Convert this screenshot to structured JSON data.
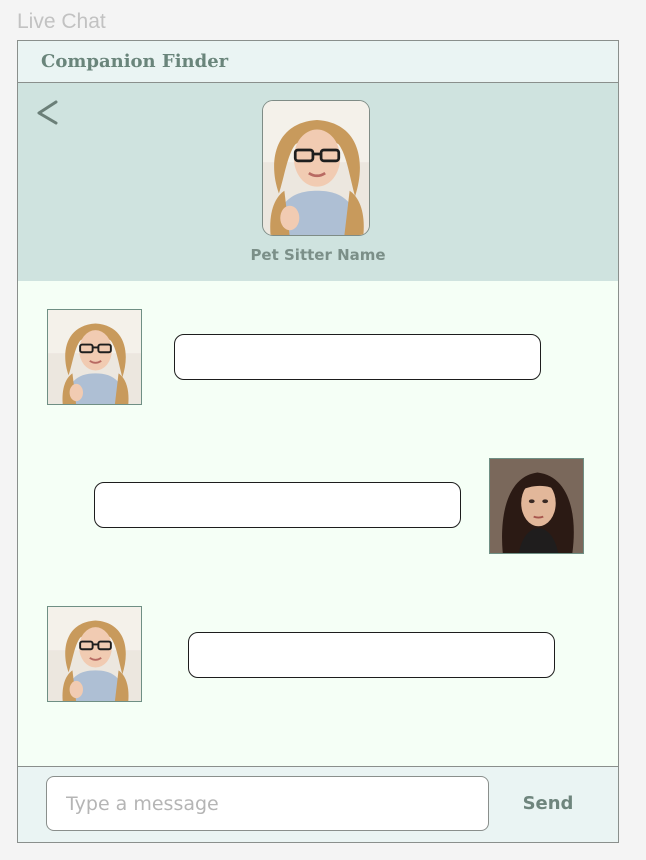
{
  "page": {
    "label": "Live Chat"
  },
  "app": {
    "title": "Companion Finder"
  },
  "profile": {
    "back_icon": "back-chevron-icon",
    "sitter_name": "Pet Sitter Name"
  },
  "messages": [
    {
      "sender": "pet-sitter",
      "text": ""
    },
    {
      "sender": "user",
      "text": ""
    },
    {
      "sender": "pet-sitter",
      "text": ""
    }
  ],
  "composer": {
    "placeholder": "Type a message",
    "value": "",
    "send_label": "Send"
  },
  "colors": {
    "header_bg": "#eaf4f3",
    "profile_band_bg": "#cfe3df",
    "chat_bg": "#f5fff6",
    "accent_text": "#6a857b"
  }
}
